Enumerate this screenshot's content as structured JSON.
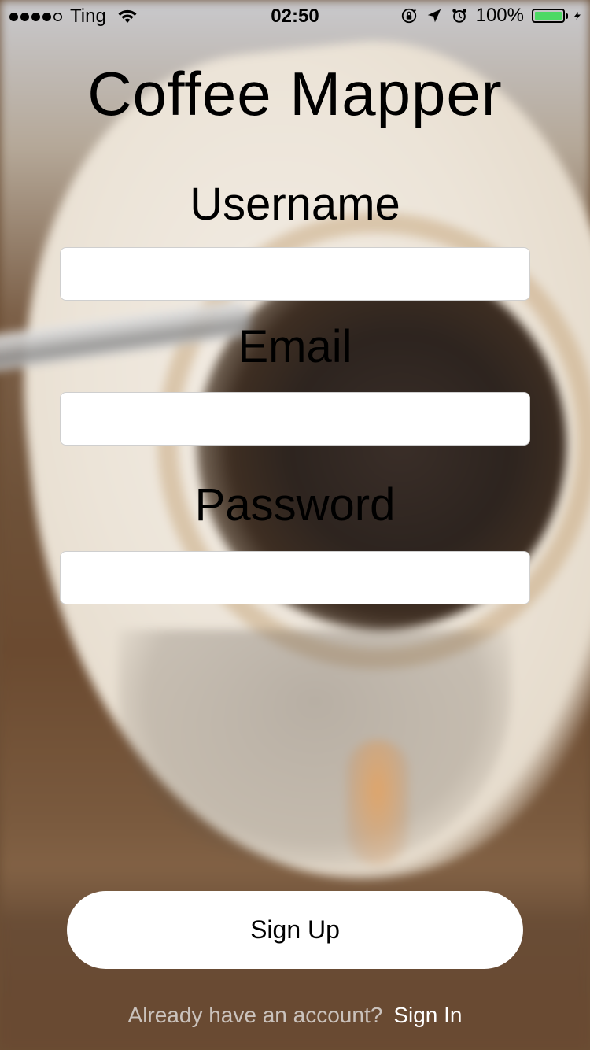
{
  "status_bar": {
    "carrier": "Ting",
    "time": "02:50",
    "battery_percent": "100%",
    "signal_bars": 4,
    "signal_total": 5,
    "battery_level": 1.0,
    "battery_color": "#4cd964"
  },
  "app": {
    "title": "Coffee Mapper"
  },
  "form": {
    "username_label": "Username",
    "username_value": "",
    "email_label": "Email",
    "email_value": "",
    "password_label": "Password",
    "password_value": ""
  },
  "actions": {
    "signup_label": "Sign Up"
  },
  "footer": {
    "prompt": "Already have an account?",
    "signin_label": "Sign In"
  }
}
